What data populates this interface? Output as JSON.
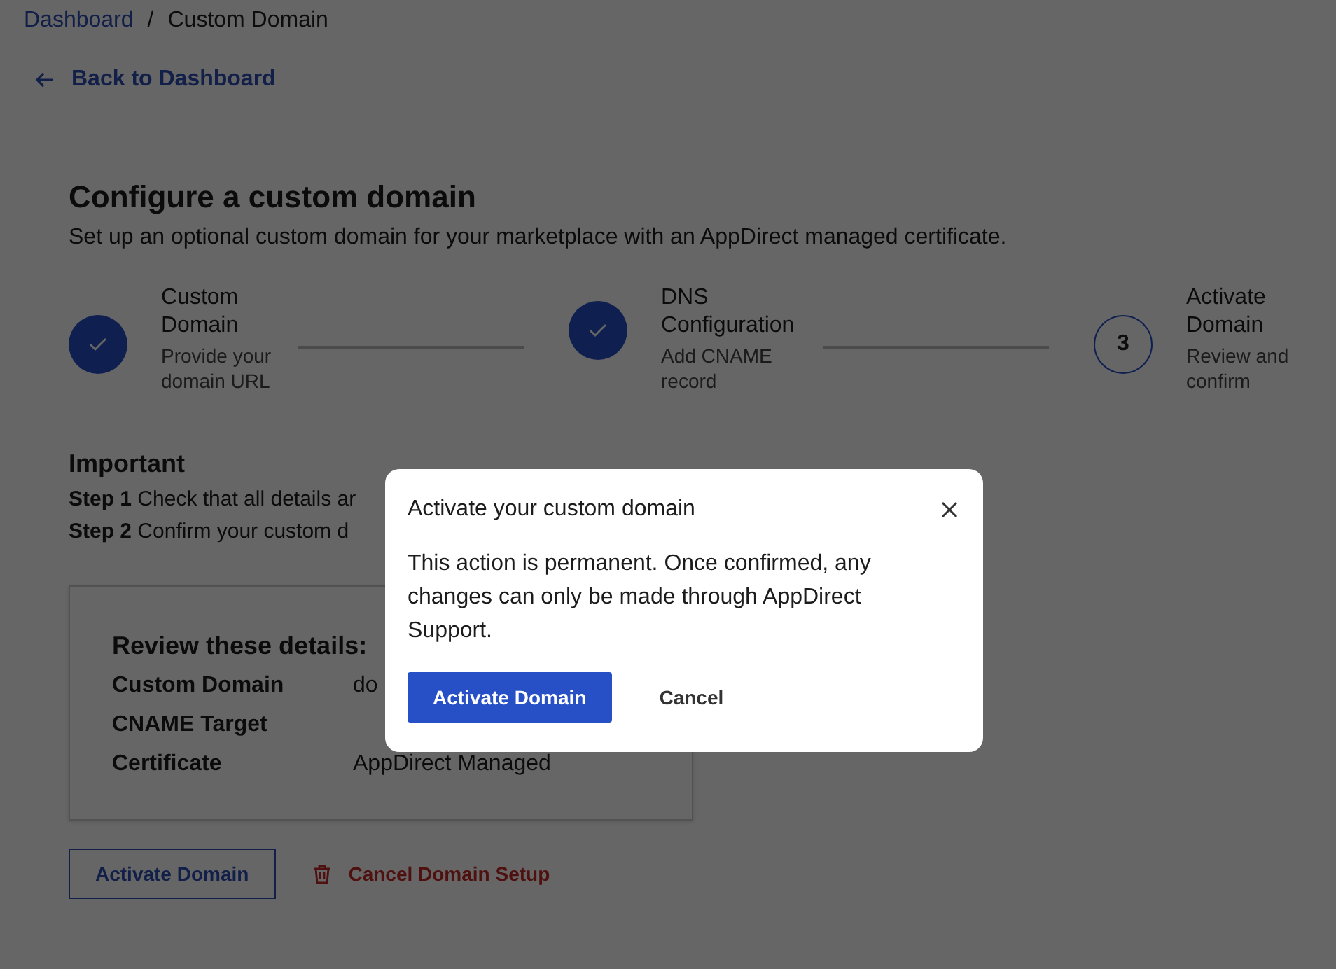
{
  "breadcrumb": [
    {
      "label": "Dashboard",
      "link": true
    },
    {
      "label": "Custom Domain",
      "link": false
    }
  ],
  "breadcrumb_separator": "/",
  "back_link": "Back to Dashboard",
  "title": "Configure a custom domain",
  "subtitle": "Set up an optional custom domain for your marketplace with an AppDirect managed certificate.",
  "steps": [
    {
      "title": "Custom Domain",
      "description": "Provide your domain URL",
      "completed": true
    },
    {
      "title": "DNS Configuration",
      "description": "Add CNAME record",
      "completed": true
    },
    {
      "title": "Activate Domain",
      "description": "Review and confirm",
      "completed": false,
      "number": "3"
    }
  ],
  "important": {
    "heading": "Important",
    "lines": [
      "**Step 1** Check that all details ar",
      "**Step 2** Confirm your custom d"
    ]
  },
  "review": {
    "heading": "Review these details:",
    "rows": [
      {
        "label": "Custom Domain",
        "value": "do"
      },
      {
        "label": "CNAME Target"
      },
      {
        "label": "Certificate",
        "value": "AppDirect Managed"
      }
    ]
  },
  "actions": {
    "primary": "Activate Domain",
    "danger": "Cancel Domain Setup"
  },
  "modal": {
    "title": "Activate your custom domain",
    "body": "This action is permanent. Once confirmed, any changes can only be made through AppDirect Support.",
    "confirm": "Activate Domain",
    "cancel": "Cancel"
  }
}
